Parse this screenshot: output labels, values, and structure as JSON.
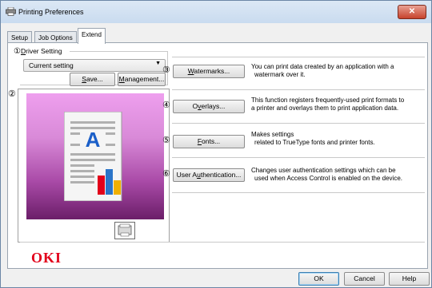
{
  "window": {
    "title": "Printing Preferences",
    "close_label": "✕"
  },
  "tabs": [
    {
      "label": "Setup",
      "active": false
    },
    {
      "label": "Job Options",
      "active": false
    },
    {
      "label": "Extend",
      "active": true
    }
  ],
  "driver_setting": {
    "number": "①",
    "label_first": "D",
    "label_rest": "river Setting",
    "current": "Current setting",
    "save_first": "S",
    "save_rest": "ave...",
    "management_first": "M",
    "management_rest": "anagement..."
  },
  "preview": {
    "number": "②"
  },
  "features": [
    {
      "number": "③",
      "button_first": "W",
      "button_rest": "atermarks...",
      "desc1": "You can print data created by an application with a",
      "desc2": "watermark over it."
    },
    {
      "number": "④",
      "button_first": "O",
      "button_mid": "v",
      "button_rest": "erlays...",
      "desc1": "This function registers frequently-used print formats to",
      "desc2": "a printer and overlays them to print application data."
    },
    {
      "number": "⑤",
      "button_first": "F",
      "button_rest": "onts...",
      "desc1": "Makes settings",
      "desc2": "related to TrueType fonts and printer fonts."
    },
    {
      "number": "⑥",
      "button_pre": "User A",
      "button_first": "u",
      "button_rest": "thentication...",
      "desc1": "Changes user authentication settings which can be",
      "desc2": "used when Access Control is enabled on the device."
    }
  ],
  "brand": "OKI",
  "footer": {
    "ok": "OK",
    "cancel": "Cancel",
    "help": "Help"
  },
  "colors": {
    "accent": "#e2001a",
    "preview_top": "#ee9fee",
    "preview_bottom": "#6b1e69"
  }
}
